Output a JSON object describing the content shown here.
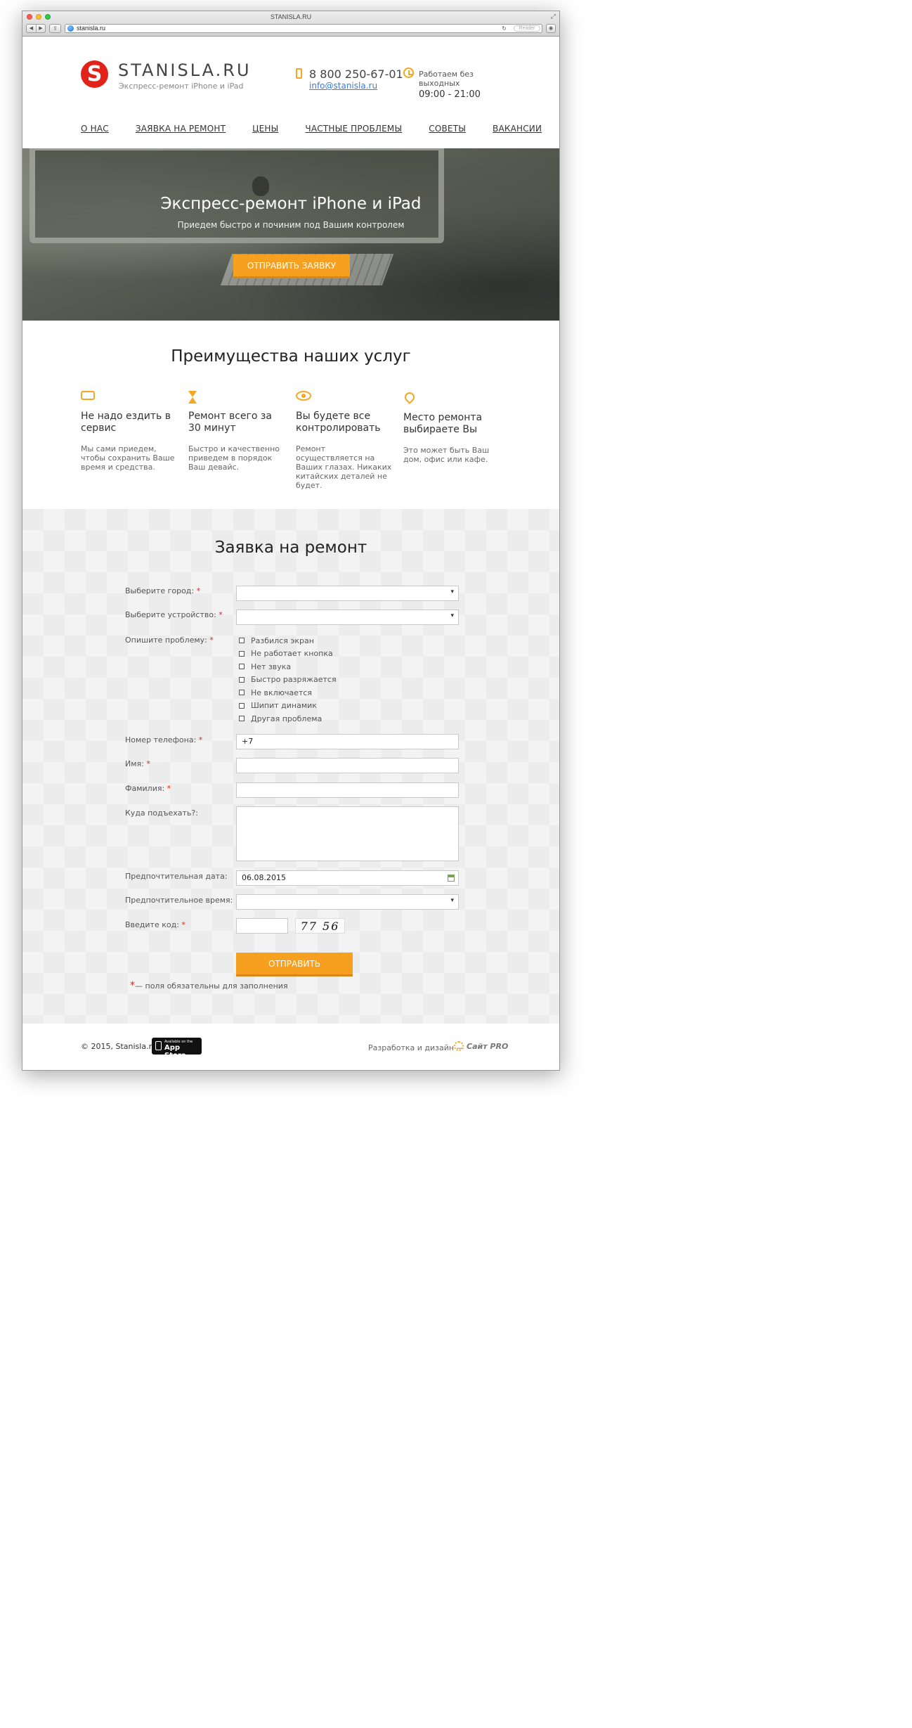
{
  "browser": {
    "window_title": "STANISLA.RU",
    "url": "stanisla.ru",
    "reader_label": "Reader"
  },
  "header": {
    "logo_letter": "S",
    "logo_text": "STANISLA.RU",
    "tagline": "Экспресс-ремонт iPhone и iPad",
    "phone": "8 800 250-67-01",
    "email": "info@stanisla.ru",
    "hours_label": "Работаем без выходных",
    "hours": "09:00 - 21:00"
  },
  "nav": [
    "О НАС",
    "ЗАЯВКА НА РЕМОНТ",
    "ЦЕНЫ",
    "ЧАСТНЫЕ ПРОБЛЕМЫ",
    "СОВЕТЫ",
    "ВАКАНСИИ"
  ],
  "hero": {
    "title": "Экспресс-ремонт iPhone и iPad",
    "subtitle": "Приедем быстро и починим под Вашим контролем",
    "button": "ОТПРАВИТЬ ЗАЯВКУ"
  },
  "benefits": {
    "title": "Преимущества наших услуг",
    "items": [
      {
        "icon": "sofa-icon",
        "head": "Не надо ездить в сервис",
        "text": "Мы сами приедем, чтобы сохранить Ваше время и средства."
      },
      {
        "icon": "hourglass-icon",
        "head": "Ремонт всего за 30 минут",
        "text": "Быстро и качественно приведем в порядок Ваш девайс."
      },
      {
        "icon": "eye-icon",
        "head": "Вы будете все контролировать",
        "text": "Ремонт осуществляется на Ваших глазах. Никаких китайских деталей не будет."
      },
      {
        "icon": "location-pin-icon",
        "head": "Место ремонта выбираете Вы",
        "text": "Это может быть Ваш дом, офис или кафе."
      }
    ]
  },
  "form": {
    "title": "Заявка на ремонт",
    "city_label": "Выберите город:",
    "device_label": "Выберите устройство:",
    "problem_label": "Опишите проблему:",
    "problems": [
      "Разбился экран",
      "Не работает кнопка",
      "Нет звука",
      "Быстро разряжается",
      "Не включается",
      "Шипит динамик",
      "Другая проблема"
    ],
    "phone_label": "Номер телефона:",
    "phone_value": "+7",
    "name_label": "Имя:",
    "surname_label": "Фамилия:",
    "address_label": "Куда подъехать?:",
    "date_label": "Предпочтительная дата:",
    "date_value": "06.08.2015",
    "time_label": "Предпочтительное время:",
    "code_label": "Введите код:",
    "captcha": "77 56",
    "submit": "ОТПРАВИТЬ",
    "required_star": "*",
    "required_note": "— поля обязательны для заполнения"
  },
  "footer": {
    "copyright": "© 2015, Stanisla.ru",
    "appstore_small": "Available on the",
    "appstore_big": "App Store",
    "dev_text": "Разработка и дизайн —",
    "dev_brand": "Сайт PRO"
  },
  "colors": {
    "accent": "#f7a01f",
    "logo_red": "#e2231a",
    "link_blue": "#3a7bd5"
  }
}
